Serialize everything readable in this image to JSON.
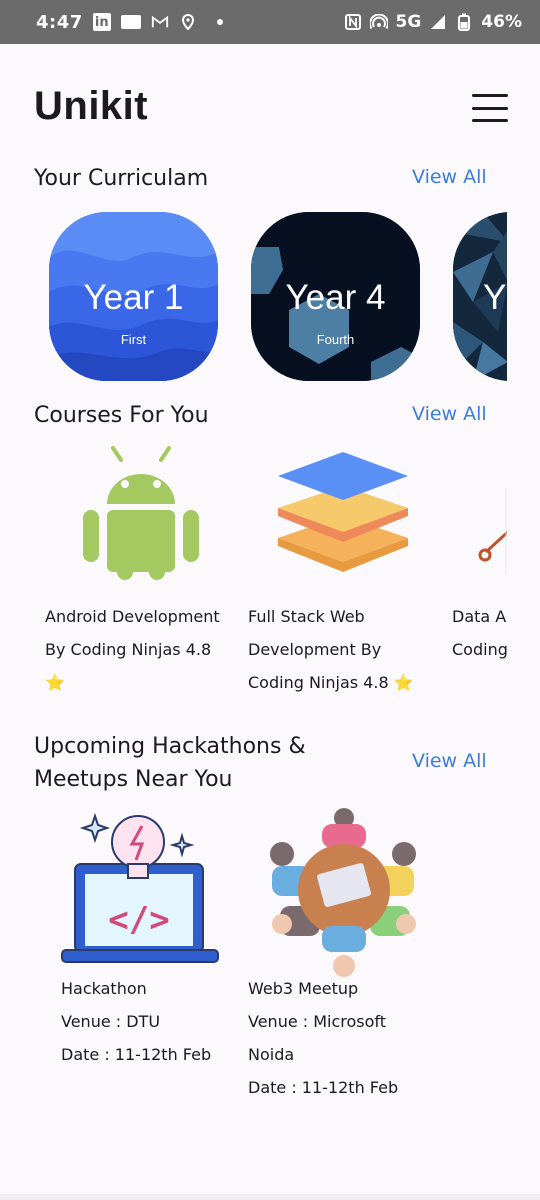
{
  "status_bar": {
    "time": "4:47",
    "icons_left": [
      "linkedin-icon",
      "news-icon",
      "gmail-icon",
      "location-icon",
      "dot-icon"
    ],
    "network": "5G",
    "battery": "46%",
    "icons_right": [
      "nfc-icon",
      "hotspot-icon",
      "signal-icon",
      "battery-icon"
    ]
  },
  "header": {
    "title": "Unikit",
    "menu_icon": "hamburger-menu-icon"
  },
  "curriculum": {
    "title": "Your Curriculam",
    "view_all": "View All",
    "cards": [
      {
        "year": "Year 1",
        "label": "First"
      },
      {
        "year": "Year 4",
        "label": "Fourth"
      },
      {
        "year": "Y",
        "label": ""
      }
    ]
  },
  "courses": {
    "title": "Courses For You",
    "view_all": "View All",
    "items": [
      {
        "icon": "android-icon",
        "line1": "Android Development",
        "line2": "By Coding Ninjas 4.8",
        "line3": "⭐"
      },
      {
        "icon": "layers-stack-icon",
        "line1": "Full Stack Web",
        "line2": "Development By",
        "line3": "Coding Ninjas 4.8 ⭐"
      },
      {
        "icon": "data-analytics-icon",
        "line1": "Data A",
        "line2": "Coding",
        "line3": ""
      }
    ]
  },
  "events": {
    "title_line1": "Upcoming Hackathons &",
    "title_line2": "Meetups Near You",
    "view_all": "View All",
    "items": [
      {
        "icon": "hackathon-laptop-icon",
        "name": "Hackathon",
        "venue": "Venue : DTU",
        "date": "Date : 11-12th Feb",
        "extra": ""
      },
      {
        "icon": "meetup-people-icon",
        "name": "Web3 Meetup",
        "venue": "Venue : Microsoft",
        "date": "Noida",
        "extra": "Date : 11-12th Feb"
      }
    ]
  },
  "colors": {
    "accent": "#3b7dd8",
    "background": "#fcf9fd",
    "status_bar": "#6b6b6b",
    "year1_card": "#2f5fe0",
    "year4_card": "#061021",
    "android_green": "#a4c961"
  }
}
